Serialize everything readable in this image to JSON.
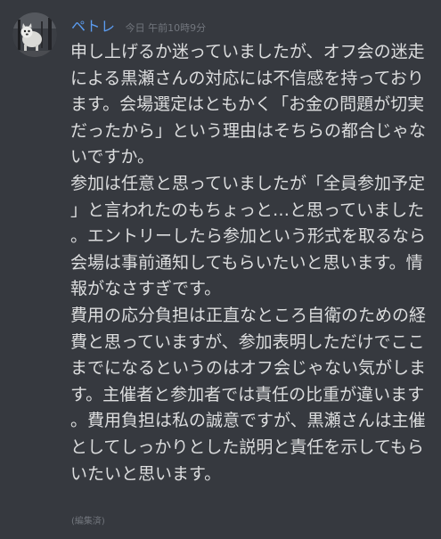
{
  "message": {
    "username": "ペトレ",
    "timestamp": "今日 午前10時9分",
    "username_color": "#5b9cf0",
    "paragraphs": [
      "申し上げるか迷っていましたが、オフ会の迷走による黒瀬さんの対応には不信感を持っております。会場選定はともかく「お金の問題が切実だったから」という理由はそちらの都合じゃないですか。",
      "参加は任意と思っていましたが「全員参加予定」と言われたのもちょっと…と思っていました。エントリーしたら参加という形式を取るなら会場は事前通知してもらいたいと思います。情報がなさすぎです。",
      "費用の応分負担は正直なところ自衛のための経費と思っていますが、参加表明しただけでここまでになるというのはオフ会じゃない気がします。主催者と参加者では責任の比重が違います。費用負担は私の誠意ですが、黒瀬さんは主催としてしっかりとした説明と責任を示してもらいたいと思います。"
    ],
    "edited_label": "(編集済)"
  },
  "colors": {
    "background": "#36393f",
    "text": "#dcddde",
    "muted": "#72767d"
  }
}
